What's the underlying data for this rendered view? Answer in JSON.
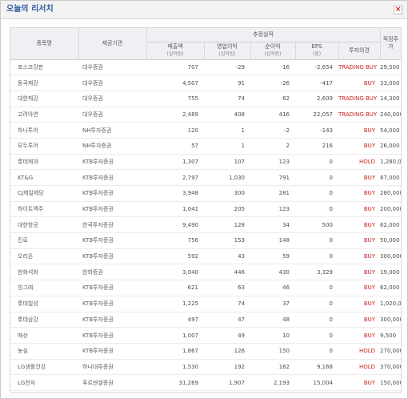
{
  "window": {
    "title": "오늘의 리서치",
    "close_label": "×"
  },
  "table": {
    "headers": {
      "stock": "종목명",
      "provider": "제공기관",
      "estimates_group": "추정실적",
      "sales": "매출액",
      "sales_unit": "(십억원)",
      "op_profit": "영업이익",
      "op_unit": "(십억원)",
      "net_profit": "순이익",
      "net_unit": "(십억원)",
      "eps": "EPS",
      "eps_unit": "(원)",
      "opinion": "투자의견",
      "target": "적정주가"
    },
    "rows": [
      {
        "name": "포스코강판",
        "provider": "대우증권",
        "sales": "707",
        "op": "-29",
        "net": "-16",
        "eps": "-2,654",
        "opinion": "TRADING BUY",
        "target": "29,500"
      },
      {
        "name": "동국제강",
        "provider": "대우증권",
        "sales": "4,507",
        "op": "91",
        "net": "-26",
        "eps": "-417",
        "opinion": "BUY",
        "target": "33,000"
      },
      {
        "name": "대한제강",
        "provider": "대우증권",
        "sales": "755",
        "op": "74",
        "net": "62",
        "eps": "2,609",
        "opinion": "TRADING BUY",
        "target": "14,300"
      },
      {
        "name": "고려아연",
        "provider": "대우증권",
        "sales": "2,489",
        "op": "408",
        "net": "416",
        "eps": "22,057",
        "opinion": "TRADING BUY",
        "target": "240,000"
      },
      {
        "name": "하나투어",
        "provider": "NH투자증권",
        "sales": "120",
        "op": "1",
        "net": "-2",
        "eps": "-143",
        "opinion": "BUY",
        "target": "54,000"
      },
      {
        "name": "모두투어",
        "provider": "NH투자증권",
        "sales": "57",
        "op": "1",
        "net": "2",
        "eps": "216",
        "opinion": "BUY",
        "target": "26,000"
      },
      {
        "name": "롯데제과",
        "provider": "KTB투자증권",
        "sales": "1,307",
        "op": "107",
        "net": "123",
        "eps": "0",
        "opinion": "HOLD",
        "target": "1,280,000"
      },
      {
        "name": "KT&G",
        "provider": "KTB투자증권",
        "sales": "2,797",
        "op": "1,030",
        "net": "791",
        "eps": "0",
        "opinion": "BUY",
        "target": "87,000"
      },
      {
        "name": "CJ제일제당",
        "provider": "KTB투자증권",
        "sales": "3,948",
        "op": "300",
        "net": "281",
        "eps": "0",
        "opinion": "BUY",
        "target": "280,000"
      },
      {
        "name": "하이트맥주",
        "provider": "KTB투자증권",
        "sales": "1,041",
        "op": "205",
        "net": "123",
        "eps": "0",
        "opinion": "BUY",
        "target": "200,000"
      },
      {
        "name": "대한항공",
        "provider": "한국투자증권",
        "sales": "9,490",
        "op": "128",
        "net": "34",
        "eps": "500",
        "opinion": "BUY",
        "target": "62,000"
      },
      {
        "name": "진로",
        "provider": "KTB투자증권",
        "sales": "756",
        "op": "153",
        "net": "148",
        "eps": "0",
        "opinion": "BUY",
        "target": "50,000"
      },
      {
        "name": "오리온",
        "provider": "KTB투자증권",
        "sales": "592",
        "op": "43",
        "net": "59",
        "eps": "0",
        "opinion": "BUY",
        "target": "300,000"
      },
      {
        "name": "한화석화",
        "provider": "한화증권",
        "sales": "3,040",
        "op": "446",
        "net": "430",
        "eps": "3,329",
        "opinion": "BUY",
        "target": "19,000"
      },
      {
        "name": "빙그레",
        "provider": "KTB투자증권",
        "sales": "621",
        "op": "63",
        "net": "46",
        "eps": "0",
        "opinion": "BUY",
        "target": "62,000"
      },
      {
        "name": "롯데칠성",
        "provider": "KTB투자증권",
        "sales": "1,225",
        "op": "74",
        "net": "37",
        "eps": "0",
        "opinion": "BUY",
        "target": "1,020,000"
      },
      {
        "name": "롯데삼강",
        "provider": "KTB투자증권",
        "sales": "497",
        "op": "47",
        "net": "48",
        "eps": "0",
        "opinion": "BUY",
        "target": "300,000"
      },
      {
        "name": "매상",
        "provider": "KTB투자증권",
        "sales": "1,007",
        "op": "49",
        "net": "10",
        "eps": "0",
        "opinion": "BUY",
        "target": "9,500"
      },
      {
        "name": "농심",
        "provider": "KTB투자증권",
        "sales": "1,867",
        "op": "126",
        "net": "150",
        "eps": "0",
        "opinion": "HOLD",
        "target": "270,000"
      },
      {
        "name": "LG생활건강",
        "provider": "하나대투증권",
        "sales": "1,530",
        "op": "192",
        "net": "162",
        "eps": "9,168",
        "opinion": "HOLD",
        "target": "370,000"
      },
      {
        "name": "LG전자",
        "provider": "푸르덴셜증권",
        "sales": "31,269",
        "op": "1,907",
        "net": "2,193",
        "eps": "15,004",
        "opinion": "BUY",
        "target": "150,000"
      }
    ]
  }
}
